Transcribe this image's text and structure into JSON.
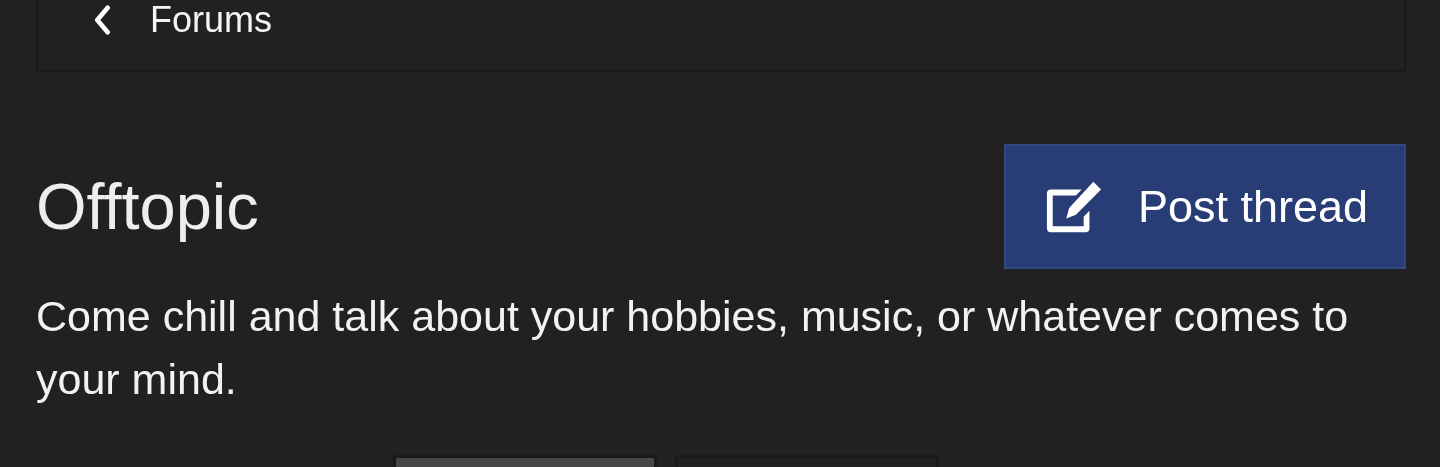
{
  "breadcrumb": {
    "label": "Forums"
  },
  "forum": {
    "title": "Offtopic",
    "description": "Come chill and talk about your hobbies, music, or whatever comes to your mind."
  },
  "actions": [
    {
      "label": "Post thread"
    }
  ],
  "filter_buttons": [
    {
      "selected": true
    },
    {
      "selected": false
    }
  ]
}
